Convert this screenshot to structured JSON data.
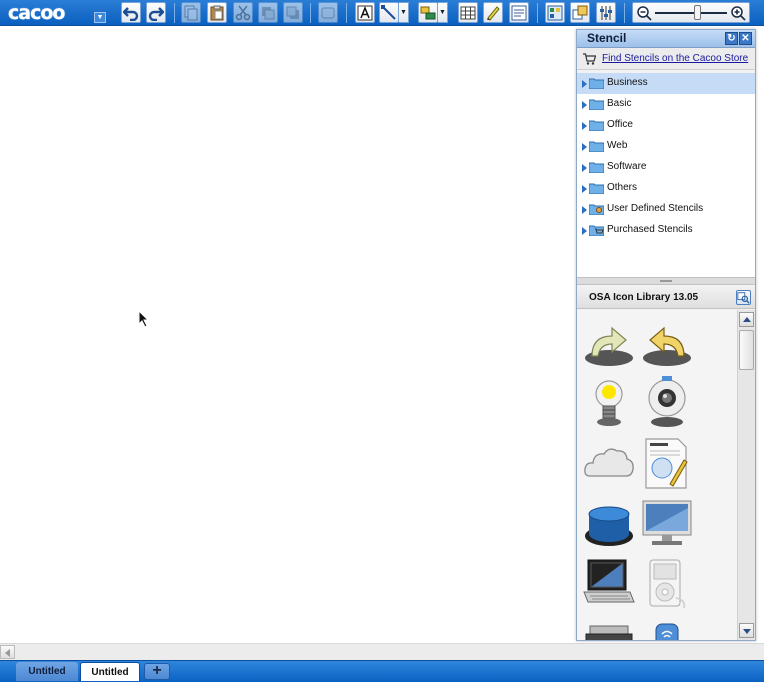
{
  "app": {
    "logo_text": "cacoo"
  },
  "stencil": {
    "title": "Stencil",
    "store_link": "Find Stencils on the Cacoo Store",
    "tree": [
      {
        "label": "Business",
        "selected": true
      },
      {
        "label": "Basic",
        "selected": false
      },
      {
        "label": "Office",
        "selected": false
      },
      {
        "label": "Web",
        "selected": false
      },
      {
        "label": "Software",
        "selected": false
      },
      {
        "label": "Others",
        "selected": false
      },
      {
        "label": "User Defined Stencils",
        "selected": false
      },
      {
        "label": "Purchased Stencils",
        "selected": false
      }
    ],
    "library": {
      "title": "OSA Icon Library 13.05",
      "icons": [
        "redo-arrow-icon",
        "undo-arrow-icon",
        "light-bulb-icon",
        "webcam-icon",
        "cloud-icon",
        "contract-document-icon",
        "database-icon",
        "monitor-icon",
        "laptop-icon",
        "ipod-icon",
        "printer-icon",
        "router-icon"
      ]
    }
  },
  "tabs": [
    {
      "label": "Untitled",
      "active": false
    },
    {
      "label": "Untitled",
      "active": true
    }
  ],
  "tab_add_label": "+",
  "colors": {
    "toolbar": "#0b5fbf",
    "accent": "#2a7ed6",
    "selection": "#c6dcf6"
  }
}
